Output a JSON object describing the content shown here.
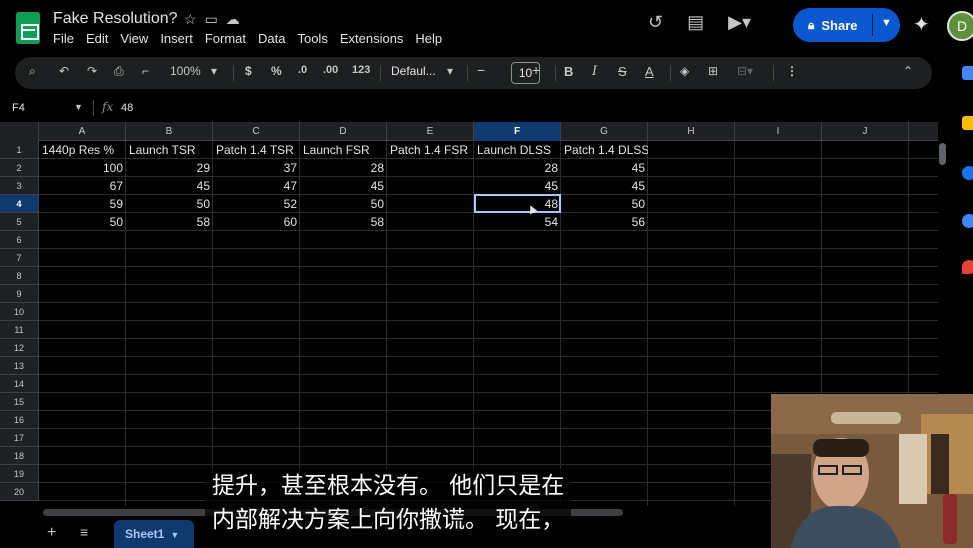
{
  "app": {
    "doc_title": "Fake Resolution?",
    "avatar_letter": "D",
    "share_label": "Share"
  },
  "menu": [
    "File",
    "Edit",
    "View",
    "Insert",
    "Format",
    "Data",
    "Tools",
    "Extensions",
    "Help"
  ],
  "toolbar": {
    "zoom": "100%",
    "currency": "$",
    "percent": "%",
    "dec_decrease": ".0",
    "dec_increase": ".00",
    "number_format": "123",
    "font": "Defaul...",
    "font_size": "10",
    "bold": "B",
    "italic": "I",
    "text_color": "A"
  },
  "formula_bar": {
    "cell_ref": "F4",
    "fx": "fx",
    "value": "48"
  },
  "grid": {
    "columns": [
      "A",
      "B",
      "C",
      "D",
      "E",
      "F",
      "G",
      "H",
      "I",
      "J"
    ],
    "selected_column": "F",
    "selected_row": "4",
    "rows": [
      "1",
      "2",
      "3",
      "4",
      "5",
      "6",
      "7",
      "8",
      "9",
      "10",
      "11",
      "12",
      "13",
      "14",
      "15",
      "16",
      "17",
      "18",
      "19",
      "20"
    ],
    "headers": [
      "1440p Res %",
      "Launch TSR",
      "Patch 1.4 TSR",
      "Launch FSR",
      "Patch 1.4 FSR",
      "Launch DLSS",
      "Patch 1.4 DLSS"
    ],
    "data": [
      [
        "100",
        "29",
        "37",
        "28",
        "",
        "28",
        "45"
      ],
      [
        "67",
        "45",
        "47",
        "45",
        "",
        "45",
        "45"
      ],
      [
        "59",
        "50",
        "52",
        "50",
        "",
        "48",
        "50"
      ],
      [
        "50",
        "58",
        "60",
        "58",
        "",
        "54",
        "56"
      ]
    ]
  },
  "sheets": {
    "active": "Sheet1"
  },
  "subtitle": {
    "line1": "提升，甚至根本没有。 他们只是在",
    "line2": "内部解决方案上向你撒谎。 现在，"
  },
  "colors": {
    "accent": "#a8c7fa",
    "share_bg": "#0b57d0",
    "selected_header": "#0e3a70",
    "sheets_green": "#0f9d58"
  },
  "icons": [
    "sheets-logo-icon",
    "star-icon",
    "move-to-folder-icon",
    "cloud-status-icon",
    "history-icon",
    "comment-icon",
    "meet-icon",
    "lock-icon",
    "gemini-spark-icon",
    "search-icon",
    "undo-icon",
    "redo-icon",
    "print-icon",
    "paint-format-icon",
    "fill-color-icon",
    "borders-icon",
    "merge-icon",
    "more-vert-icon",
    "collapse-icon",
    "add-sheet-icon",
    "all-sheets-icon"
  ]
}
